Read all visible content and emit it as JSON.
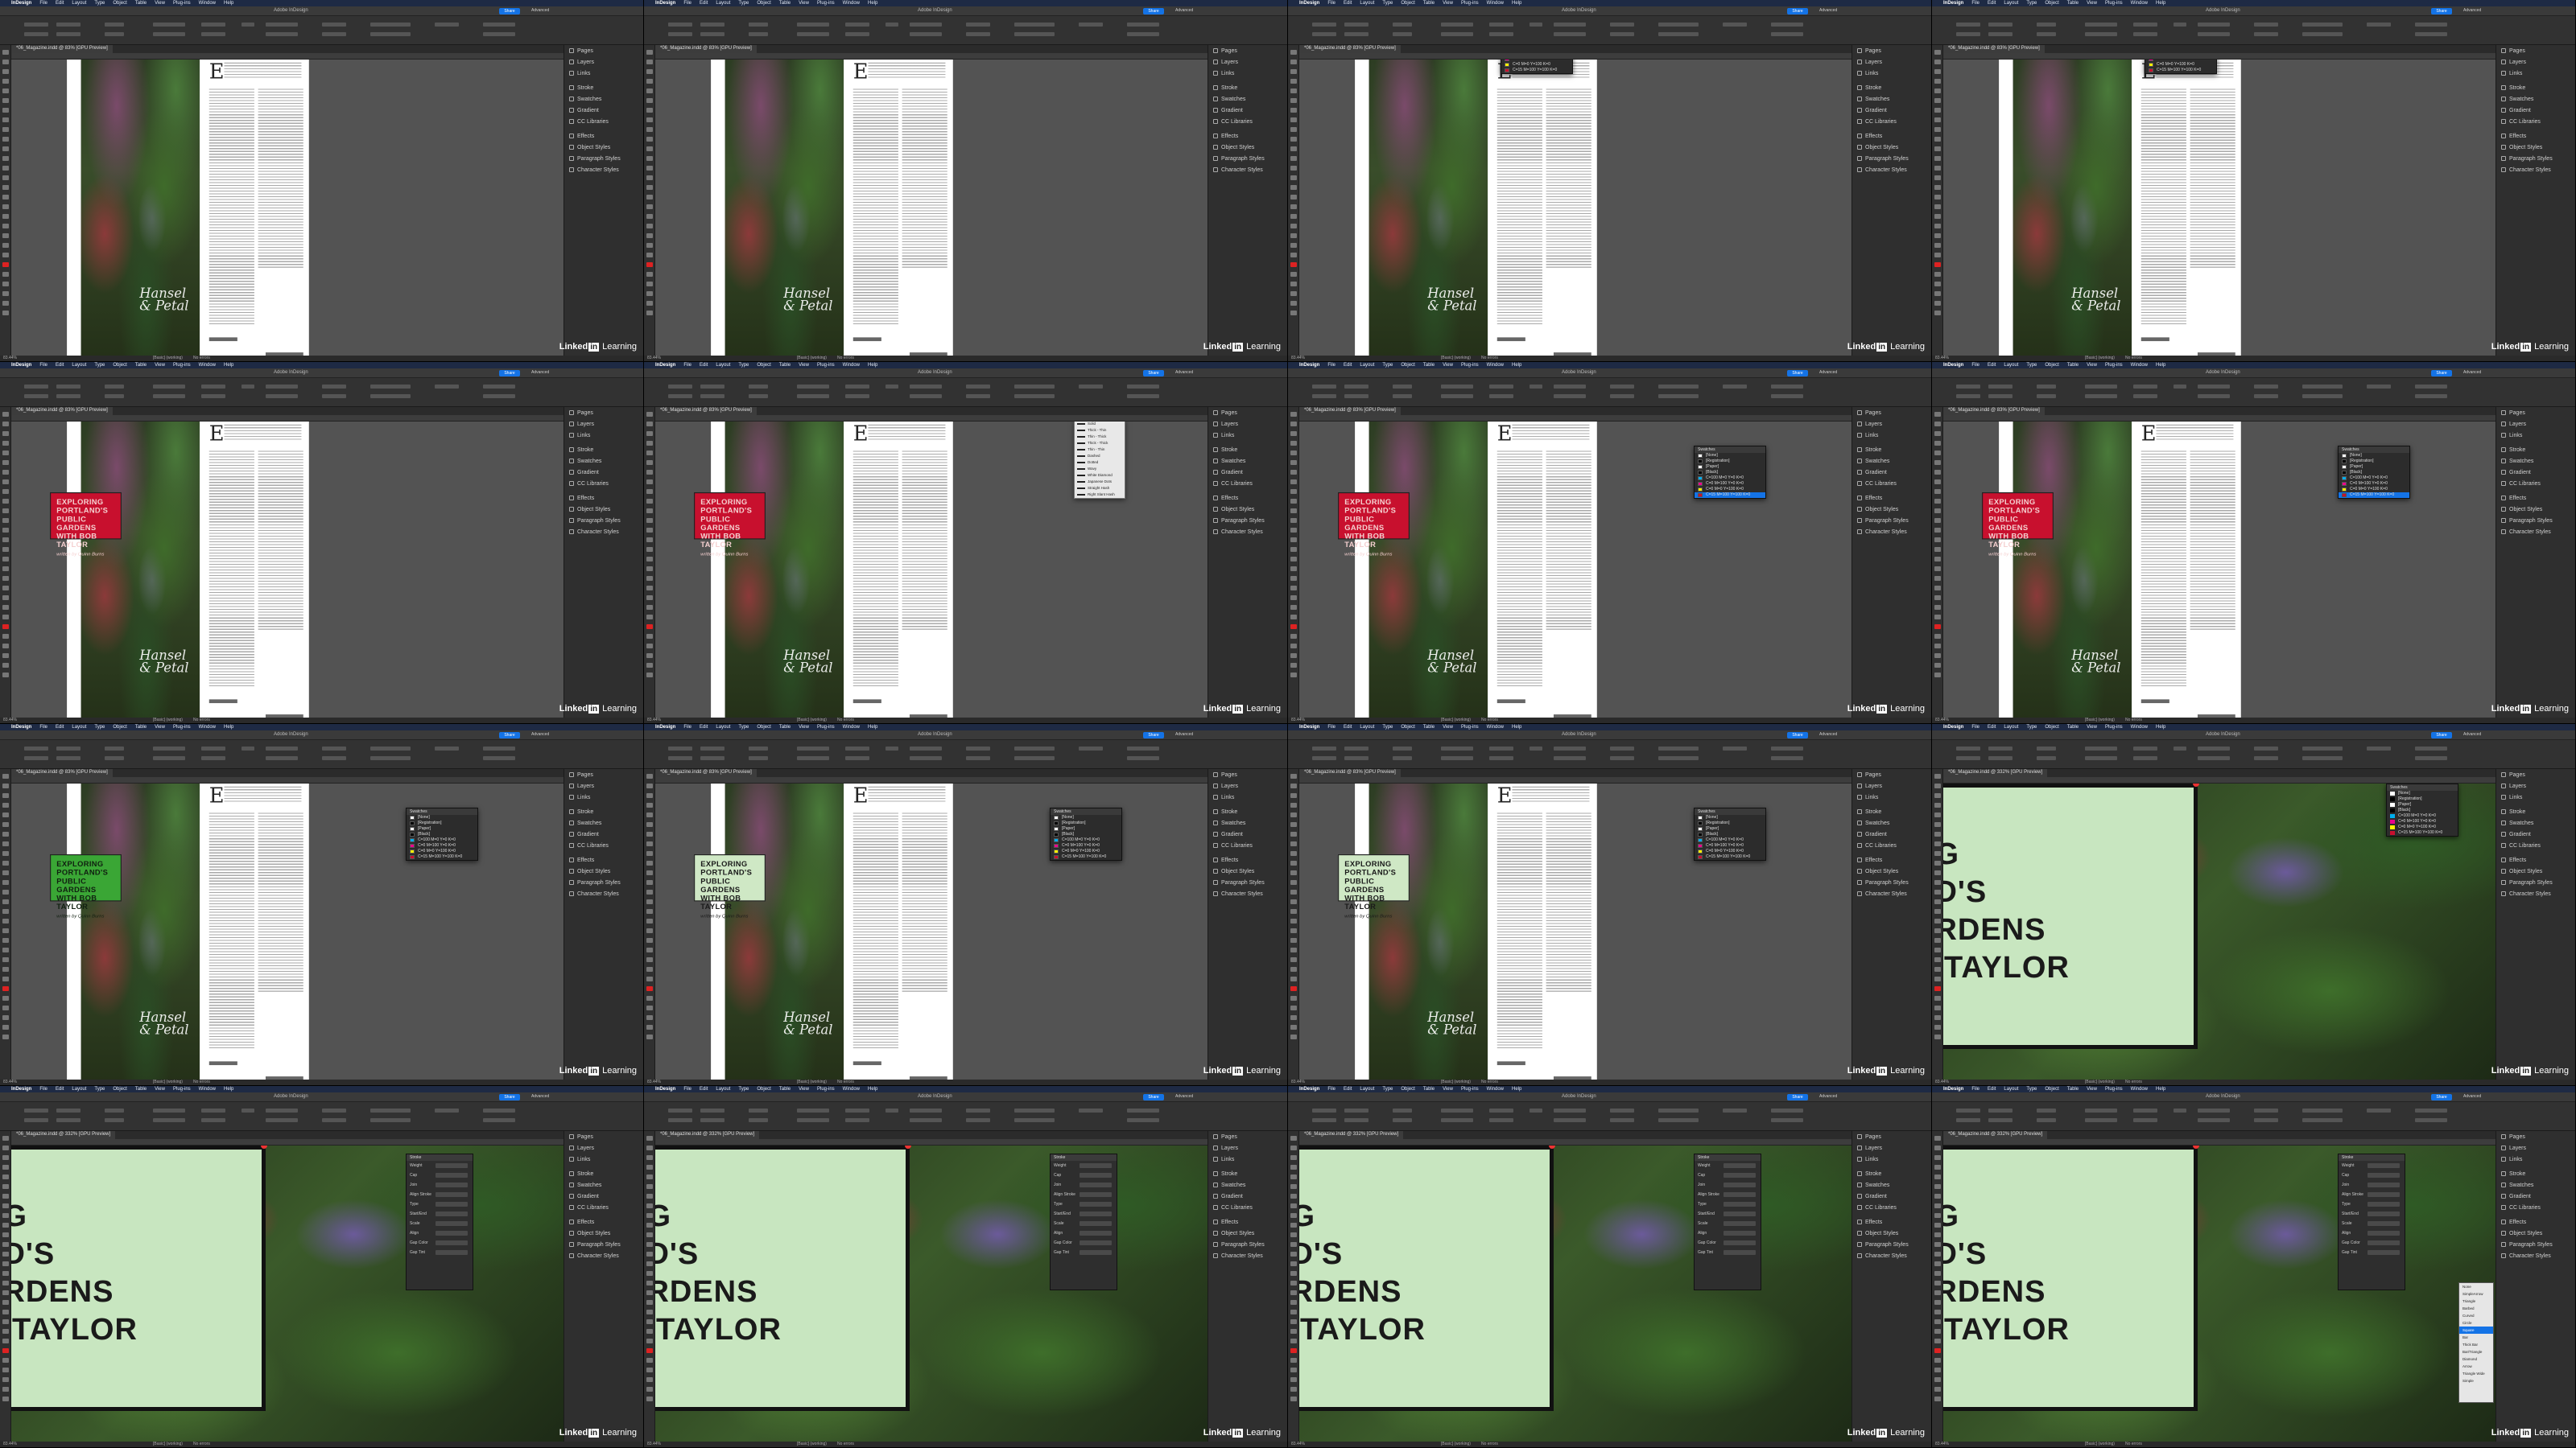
{
  "app": {
    "menu": [
      "InDesign",
      "File",
      "Edit",
      "Layout",
      "Type",
      "Object",
      "Table",
      "View",
      "Plug-ins",
      "Window",
      "Help"
    ],
    "title": "Adobe InDesign",
    "share_label": "Share",
    "workspace": "Advanced",
    "doc_tab": "*06_Magazine.indd @ 83% [GPU Preview]",
    "doc_tab_zoom": "*06_Magazine.indd @ 332% [GPU Preview]",
    "status_zoom": "83.44%",
    "status_style": "[Basic] (working)",
    "status_errors": "No errors",
    "watermark_a": "Linked",
    "watermark_b": "in",
    "watermark_c": " Learning"
  },
  "panels": [
    "Pages",
    "Layers",
    "Links",
    "Stroke",
    "Swatches",
    "Gradient",
    "CC Libraries",
    "Effects",
    "Object Styles",
    "Paragraph Styles",
    "Character Styles"
  ],
  "article": {
    "title_line1": "EXPLORING",
    "title_line2": "PORTLAND'S",
    "title_line3": "PUBLIC GARDENS",
    "title_line4": "WITH BOB TAYLOR",
    "byline": "written by Quinn Burns",
    "logo": "Hansel & Petal",
    "dropcap": "E"
  },
  "zoom_text": {
    "l1": "NG",
    "l2": "ND'S",
    "l3": "ARDENS",
    "l4": "B TAYLOR"
  },
  "swatches": {
    "title": "Swatches",
    "rows": [
      "[None]",
      "[Registration]",
      "[Paper]",
      "[Black]",
      "C=100 M=0 Y=0 K=0",
      "C=0 M=100 Y=0 K=0",
      "C=0 M=0 Y=100 K=0",
      "C=15 M=100 Y=100 K=0"
    ],
    "colors": [
      "#ffffff",
      "#000000",
      "#ffffff",
      "#000000",
      "#00aeef",
      "#ec008c",
      "#fff200",
      "#c8102e"
    ]
  },
  "stroke_menu": {
    "items": [
      "Solid",
      "Thick - Thin",
      "Thin - Thick",
      "Thick - Thick",
      "Thin - Thin",
      "Dashed",
      "Dotted",
      "Wavy",
      "White Diamond",
      "Japanese Dots",
      "Straight Hash",
      "Right Slant Hash"
    ]
  },
  "stroke_panel": {
    "title": "Stroke",
    "rows": [
      "Weight",
      "Cap",
      "Join",
      "Align Stroke",
      "Type",
      "Start/End",
      "Scale",
      "Align",
      "Gap Color",
      "Gap Tint"
    ]
  },
  "type_menu": {
    "items": [
      "None",
      "SimpleArrow",
      "Triangle",
      "Barbed",
      "Curved",
      "Circle",
      "Square",
      "Bar",
      "Thick Bar",
      "Bar/Triangle",
      "Diamond",
      "Arrow",
      "Triangle Wide",
      "Simple"
    ]
  },
  "colors": {
    "red_box": "#c8102e",
    "green_box": "#3aa635",
    "pale_green_box": "#cfe8c5",
    "accent": "#1473e6"
  }
}
